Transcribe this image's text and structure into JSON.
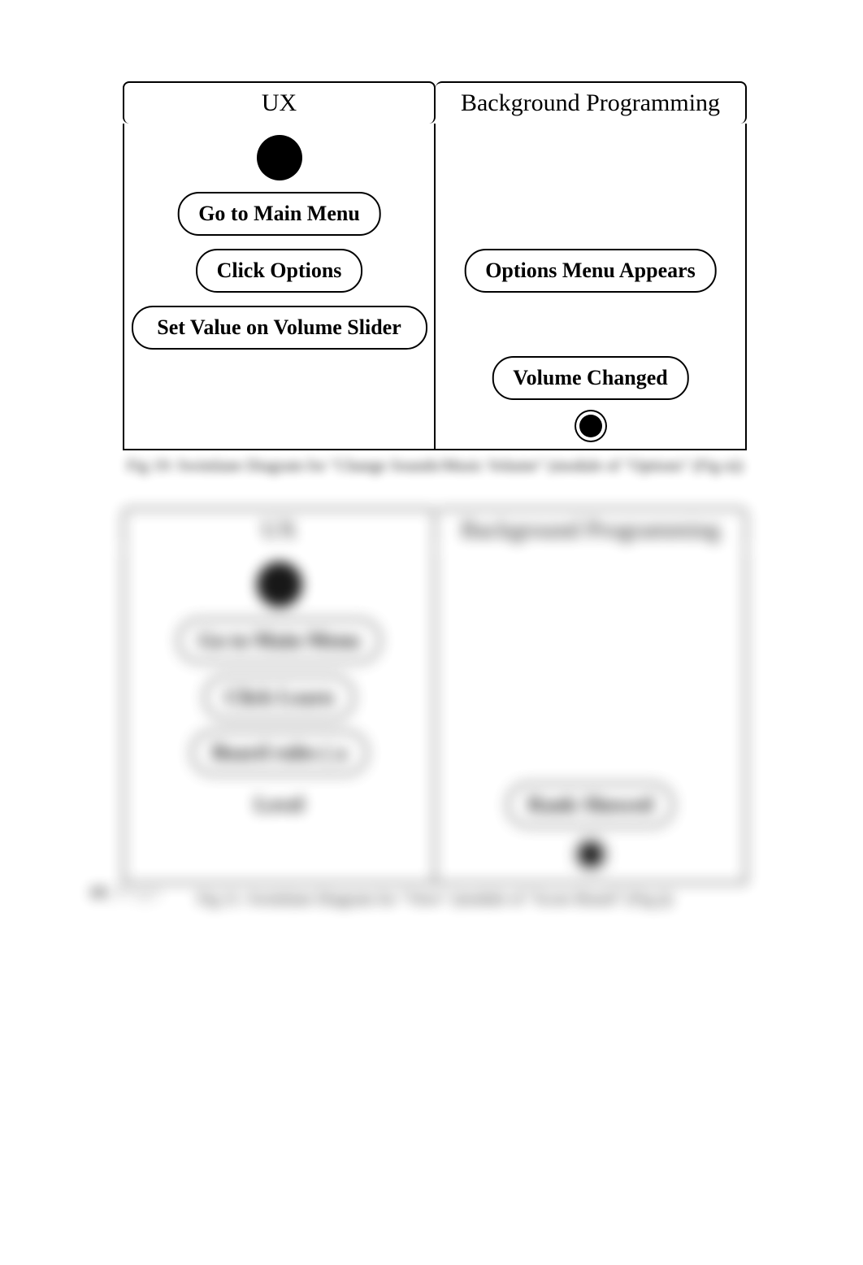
{
  "lane_left": "UX",
  "lane_right": "Background Programming",
  "d1": {
    "a1": "Go to Main Menu",
    "a2": "Click Options",
    "a3": "Set Value on Volume Slider",
    "b1": "Options Menu Appears",
    "b2": "Volume Changed",
    "caption": "Fig 19: Swimlane Diagram for \"Change Sounds/Music Volume\" (module of \"Options\" (Fig n))"
  },
  "d2": {
    "a1": "Go to Main Menu",
    "a2": "Click Learn",
    "a3": "Board rules ( a",
    "a4": "Level",
    "b1": "Rank Showed",
    "caption": "Fig 21: Swimlane Diagram for \"View\" (module of \"Score Board\" (Fig j))"
  },
  "page_num": "10 ",
  "page_word": "| P a g e"
}
